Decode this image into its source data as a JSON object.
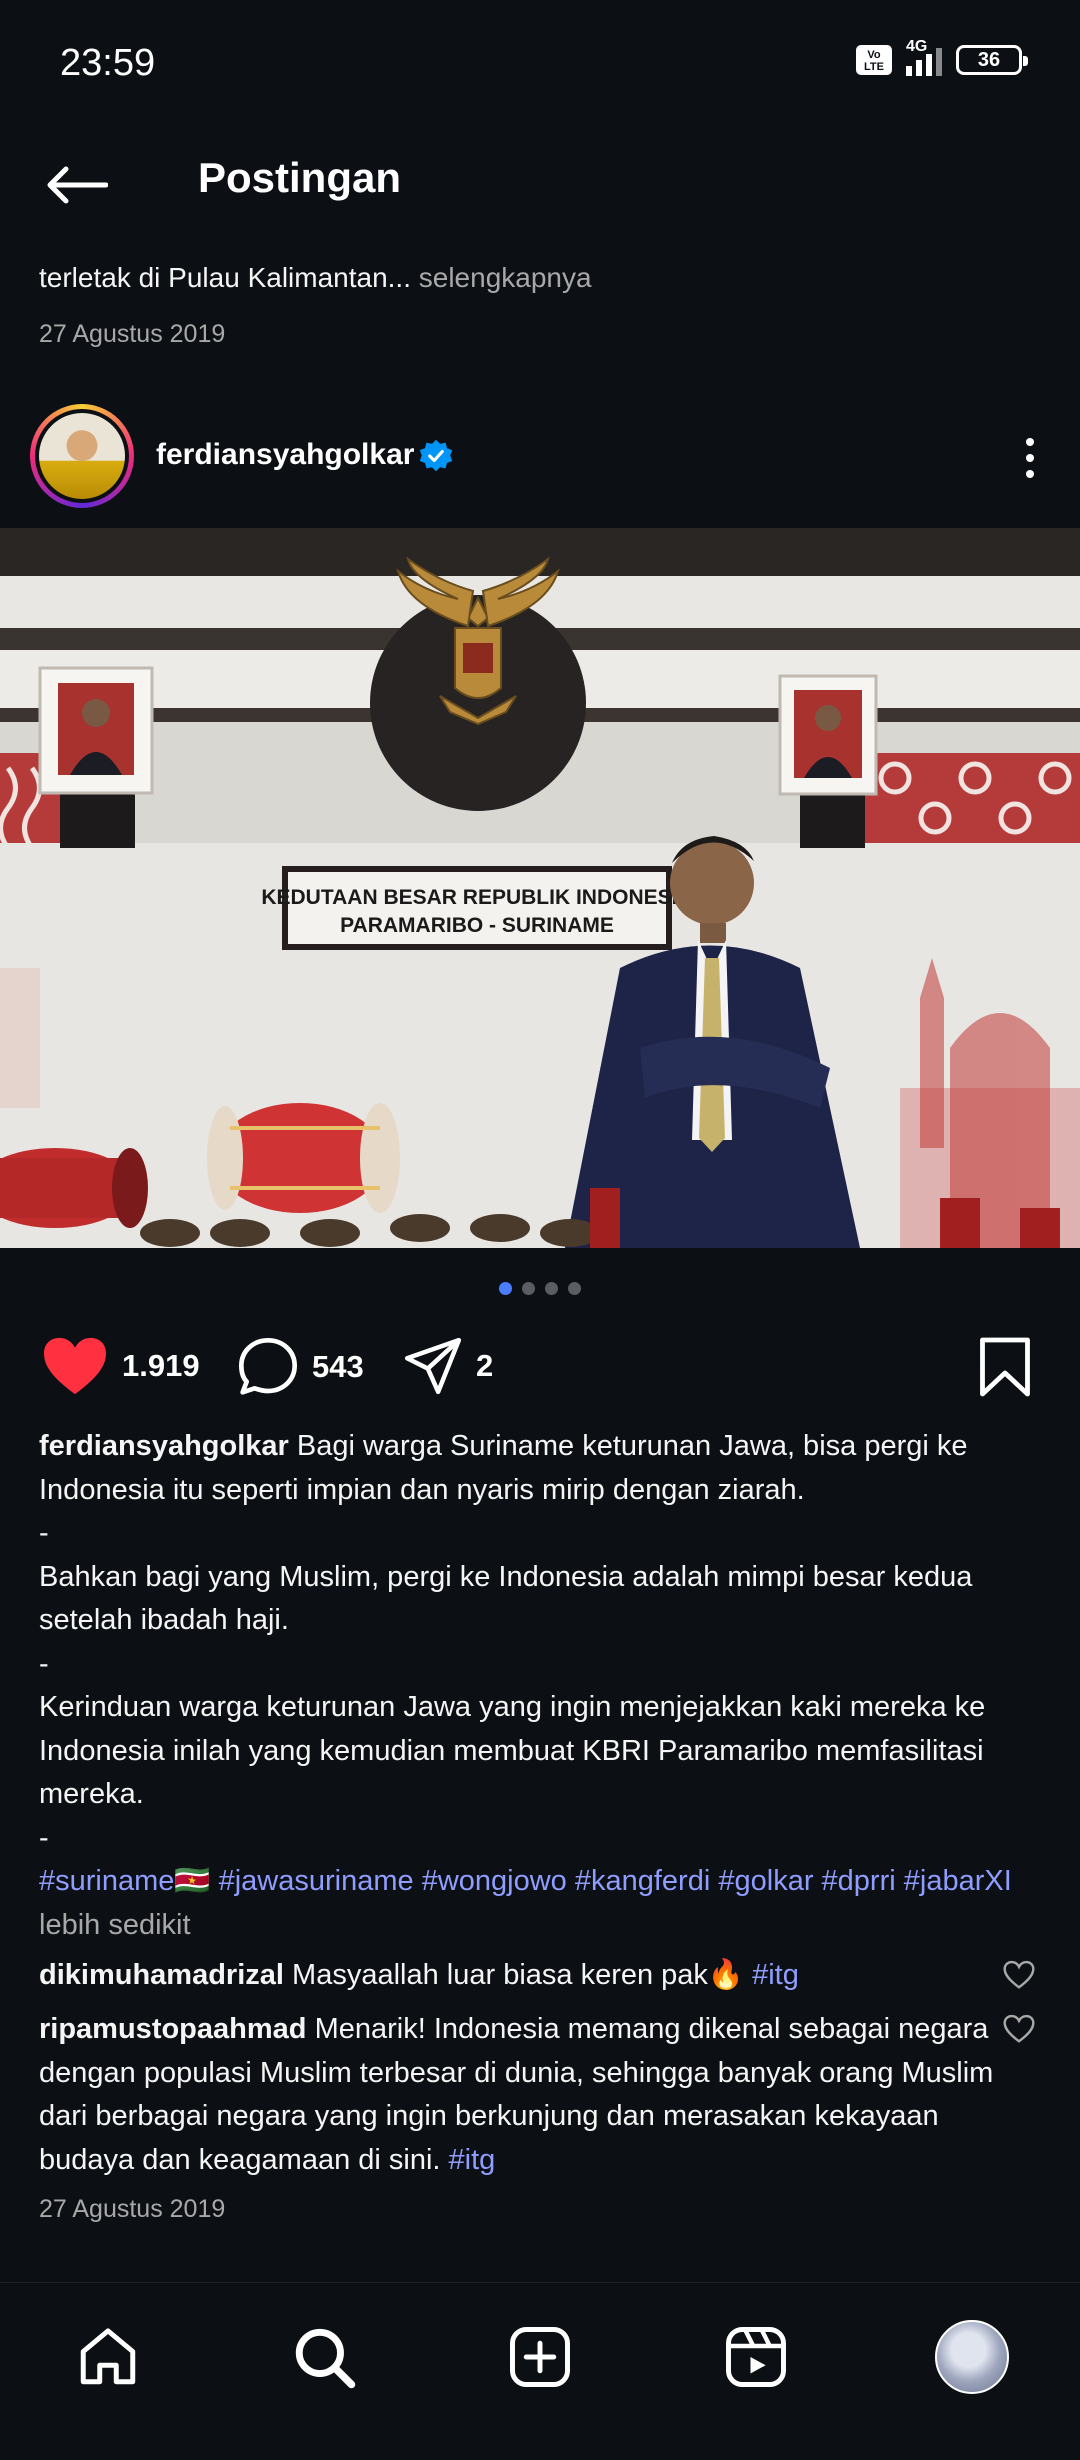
{
  "status": {
    "time": "23:59",
    "network": "4G",
    "volte": "Vo LTE",
    "battery": "36"
  },
  "header": {
    "title": "Postingan"
  },
  "previous_post": {
    "caption": "terletak di Pulau Kalimantan...",
    "more": "selengkapnya",
    "date": "27 Agustus 2019"
  },
  "post": {
    "username": "ferdiansyahgolkar",
    "image": {
      "sign_line1": "KEDUTAAN BESAR REPUBLIK INDONESIA",
      "sign_line2": "PARAMARIBO - SURINAME",
      "carousel_count": 4,
      "carousel_active": 1
    },
    "likes": "1.919",
    "comments": "543",
    "shares": "2",
    "caption": {
      "text1": "Bagi warga Suriname keturunan Jawa, bisa pergi ke Indonesia itu seperti impian dan nyaris mirip dengan ziarah.",
      "sep1": "-",
      "text2": "Bahkan bagi yang Muslim, pergi ke Indonesia adalah mimpi besar kedua setelah ibadah haji.",
      "sep2": "-",
      "text3": "Kerinduan warga keturunan Jawa yang ingin menjejakkan kaki mereka ke Indonesia inilah yang kemudian membuat KBRI Paramaribo memfasilitasi mereka.",
      "sep3": "-",
      "tag1": "#suriname",
      "flag": "🇸🇷",
      "tag2": "#jawasuriname",
      "tag3": "#wongjowo",
      "tag4": "#kangferdi",
      "tag5": "#golkar",
      "tag6": "#dprri",
      "tag7": "#jabarXI",
      "less": "lebih sedikit"
    },
    "comment_list": [
      {
        "username": "dikimuhamadrizal",
        "text": "Masyaallah luar biasa keren pak🔥",
        "tag": "#itg"
      },
      {
        "username": "ripamustopaahmad",
        "text": "Menarik! Indonesia memang dikenal sebagai negara dengan populasi Muslim terbesar di dunia, sehingga banyak orang Muslim dari berbagai negara yang ingin berkunjung dan merasakan kekayaan budaya dan keagamaan di sini.",
        "tag": "#itg"
      }
    ],
    "date": "27 Agustus 2019"
  },
  "colors": {
    "background": "#0c1014",
    "like": "#ff3040",
    "hashtag": "#8f9dff",
    "muted": "#a8a8a8",
    "verified": "#0095f6",
    "carousel_active": "#4a7dff"
  },
  "nav": {
    "items": [
      "home-icon",
      "search-icon",
      "create-icon",
      "reels-icon",
      "profile-avatar"
    ],
    "active": "search-icon"
  }
}
